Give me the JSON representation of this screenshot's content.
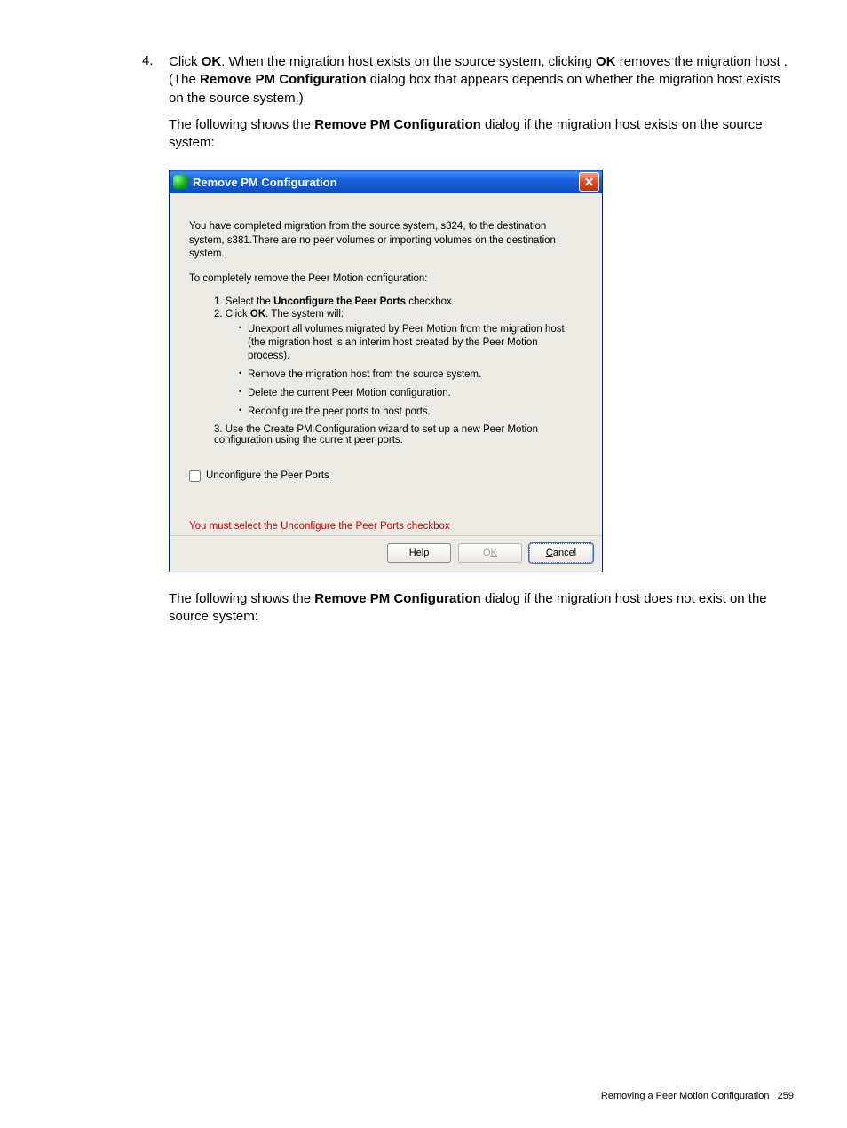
{
  "step": {
    "number": "4.",
    "sentence1_pre": "Click ",
    "sentence1_bold1": "OK",
    "sentence1_mid": ". When the migration host exists on the source system, clicking ",
    "sentence1_bold2": "OK",
    "sentence1_post": " removes the migration host . (The ",
    "sentence1_bold3": "Remove PM Configuration",
    "sentence1_end": " dialog box that appears depends on whether the migration host exists on the source system.)",
    "sentence2_pre": "The following shows the ",
    "sentence2_bold": "Remove PM Configuration",
    "sentence2_post": " dialog if the migration host exists on the source system:"
  },
  "dialog": {
    "title": "Remove PM Configuration",
    "close_glyph": "✕",
    "intro": "You have completed migration from the source system, s324, to the destination system, s381.There are no peer volumes or importing volumes on the destination system.",
    "subhead": "To completely remove the Peer Motion configuration:",
    "items": {
      "n1_pre": "1.  Select the ",
      "n1_bold": "Unconfigure the Peer Ports",
      "n1_post": " checkbox.",
      "n2_pre": "2.  Click ",
      "n2_bold": "OK",
      "n2_post": ". The system will:",
      "b1": "Unexport all volumes migrated by Peer Motion from the migration host (the migration host is an interim host created by the Peer Motion process).",
      "b2": "Remove the migration host from the source system.",
      "b3": "Delete the current Peer Motion configuration.",
      "b4": "Reconfigure the peer ports to host ports.",
      "n3": "3.  Use the Create PM Configuration wizard to set up a new Peer Motion configuration using the current peer ports."
    },
    "checkbox_label": "Unconfigure the Peer Ports",
    "hint": "You must select the Unconfigure the Peer Ports checkbox",
    "buttons": {
      "help": "Help",
      "ok_pre": "O",
      "ok_u": "K",
      "cancel_u": "C",
      "cancel_post": "ancel"
    }
  },
  "after": {
    "pre": "The following shows the ",
    "bold": "Remove PM Configuration",
    "post": " dialog if the migration host does not exist on the source system:"
  },
  "footer": {
    "text": "Removing a Peer Motion Configuration",
    "page": "259"
  }
}
